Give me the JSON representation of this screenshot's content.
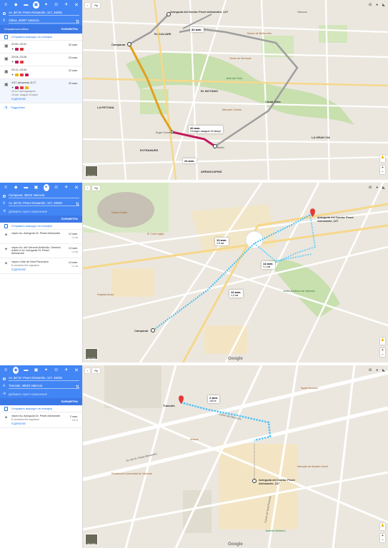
{
  "panel1": {
    "origin": "Av. del Dr. Peset Aleixandre, 127, 46035",
    "destination": "Xàtiva, 46007 Valencia",
    "depart_label": "Отправиться сейчас",
    "options_label": "ПАРАМЕТРЫ",
    "send_label": "Отправить маршрут на телефон",
    "routes": [
      {
        "times": "22:59–23:31",
        "duration": "32 мин.",
        "chips": [
          "#c2185b",
          "#d32f2f"
        ]
      },
      {
        "times": "23:04–23:28",
        "duration": "24 мин.",
        "chips": [
          "#c2185b",
          "#e53935"
        ]
      },
      {
        "times": "23:12–23:34",
        "duration": "22 мин.",
        "chips": [
          "#f4b400",
          "#e53935",
          "#c2185b"
        ]
      },
      {
        "times": "4:57 (вторник)–5:17",
        "duration": "20 мин.",
        "chips": [
          "#c2185b",
          "#e53935",
          "#f4b400"
        ],
        "sub1": "4:5 из Сорольдикарнте",
        "sub2": "15 мин.   каждые 40 минут",
        "link": "ПОДРОБНЕЕ"
      }
    ],
    "more_label": "Подробнее"
  },
  "panel2": {
    "origin": "Campanar, 46015 Valencia",
    "destination": "Av. del Dr. Peset Aleixandre, 127, 46035",
    "add_label": "Добавить пункт назначения",
    "options_label": "ПАРАМЕТРЫ",
    "send_label": "Отправить маршрут на телефон",
    "routes": [
      {
        "title": "через Av. Avinguda Dr. Peset Aleixandre",
        "duration": "12 мин.",
        "dist": "1,0 км"
      },
      {
        "title": "через Av. del General Avilés/Av. General Avilés и Av. Avinguda Dr. Peset Aleixandre",
        "duration": "13 мин.",
        "dist": "1,0 км"
      },
      {
        "title": "через Calle de Sant Pancracio",
        "duration": "14 мин.",
        "dist": "1,1 км",
        "sub": "В основном без подъемов",
        "link": "ПОДРОБНЕЕ"
      }
    ]
  },
  "panel3": {
    "origin": "Av. del Dr. Peset Aleixandre, 127, 46035",
    "destination": "Tramuits, 46023 Valencia",
    "add_label": "Добавить пункт назначения",
    "options_label": "ПАРАМЕТРЫ",
    "send_label": "Отправить маршрут на телефон",
    "routes": [
      {
        "title": "через Av. Avinguda Dr. Peset Aleixandre",
        "duration": "2 мин.",
        "dist": "140 м",
        "sub": "В основном без подъемов",
        "link": "ПОДРОБНЕЕ"
      }
    ]
  },
  "map1": {
    "layer": "Ру",
    "dest": "Avinguda del Doctor Peset Aleixandre, 127",
    "callout1": "32 мин.",
    "callout2": "26 мин.",
    "callout2sub": "Отходит каждые 40 минут",
    "callout3": "24 мин.",
    "labels": [
      "EL CALVARI",
      "LA PETXINA",
      "EL BOTÀNIC",
      "LA GRAN VIA",
      "ARRANCAPINS",
      "Campanar",
      "Àngel Guimerà",
      "Bailèn",
      "Jardí del Túria",
      "Mercado Central",
      "Ciutat Vella",
      "Vilanova",
      "EXTRAMURS",
      "Torres de Serranos",
      "Museu de Belles Arts"
    ],
    "satellite": "Спутник"
  },
  "map2": {
    "layer": "Ру",
    "dest": "Avinguda del Doctor Peset Aleixandre, 127",
    "origin": "Campanar",
    "callout1": "13 мин.",
    "callout1sub": "1,0 км",
    "callout2": "14 мин.",
    "callout2sub": "1,1 км",
    "callout3": "12 мин.",
    "callout3sub": "1,0 км",
    "labels": [
      "Nuevo Centro",
      "El Corte Inglés",
      "Jardín Botánico de Valencia",
      "Hospital Arnau",
      "Campanar"
    ],
    "satellite": "Спутник",
    "google": "Google"
  },
  "map3": {
    "layer": "Ру",
    "origin": "Tramuits",
    "dest": "Avinguda del Doctor Peset Aleixandre, 127",
    "callout": "2 мин.",
    "calloutsub": "140 м",
    "labels": [
      "Carrer del Morvedre",
      "Av. del Dr. Peset Aleixandre",
      "Carrer de Sant Pancraç",
      "Supermercado",
      "Antena",
      "Residencia Comunidad de Valencia",
      "Mercado de Mossèn Sorell",
      "Jardines Botánico"
    ],
    "satellite": "Спутник",
    "google": "Google"
  },
  "colors": {
    "header": "#4285f4",
    "walk": "#4fc3f7",
    "bus": "#c2185b",
    "metro": "#f4b400"
  }
}
